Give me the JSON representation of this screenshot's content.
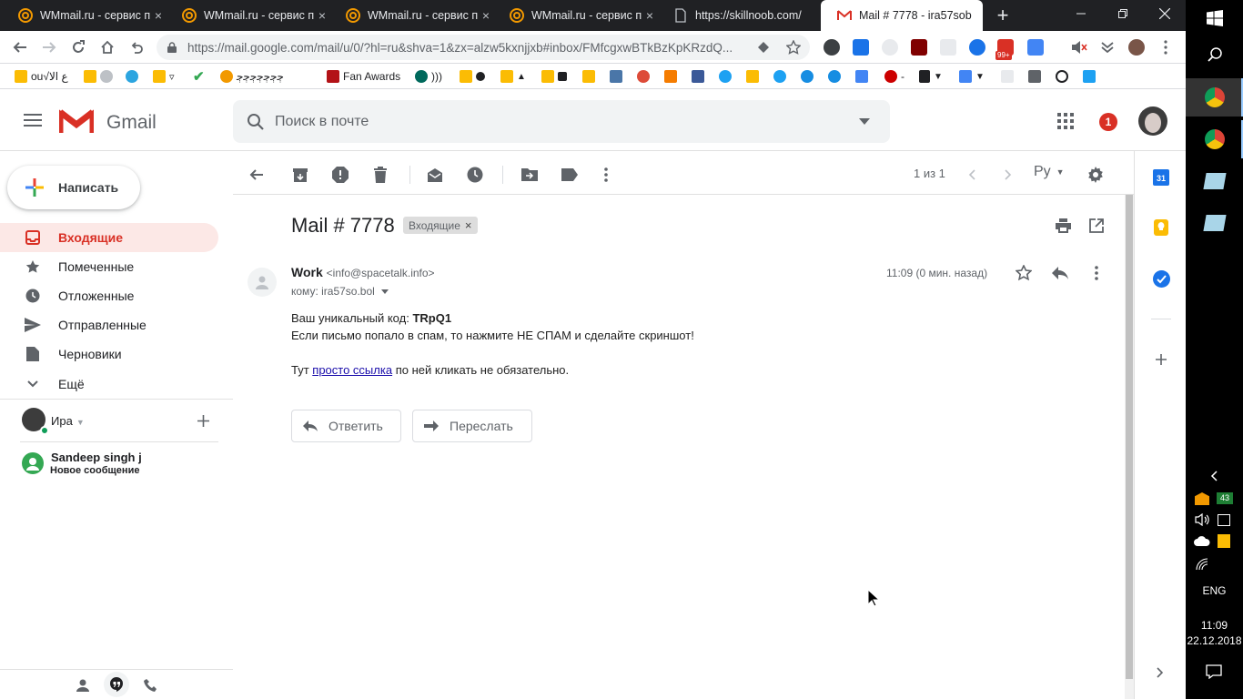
{
  "browser": {
    "tabs": [
      {
        "title": "WMmail.ru - сервис п",
        "active": false
      },
      {
        "title": "WMmail.ru - сервис п",
        "active": false
      },
      {
        "title": "WMmail.ru - сервис п",
        "active": false
      },
      {
        "title": "WMmail.ru - сервис п",
        "active": false
      },
      {
        "title": "https://skillnoob.com/",
        "active": false
      },
      {
        "title": "Mail # 7778 - ira57sob",
        "active": true
      }
    ],
    "url": "https://mail.google.com/mail/u/0/?hl=ru&shva=1&zx=alzw5kxnjjxb#inbox/FMfcgxwBTkBzKpKRzdQ...",
    "ext_badge": "99+",
    "bookmarks": {
      "b1": "ou√ع الا",
      "b5": "ﭴﭴﭴﭴﭴﭴﭴ",
      "b6": "Fan Awards",
      "b7": ")))"
    }
  },
  "gmail": {
    "logo_text": "Gmail",
    "search_placeholder": "Поиск в почте",
    "notif_count": "1",
    "compose_label": "Написать",
    "nav": {
      "inbox": "Входящие",
      "starred": "Помеченные",
      "snoozed": "Отложенные",
      "sent": "Отправленные",
      "drafts": "Черновики",
      "more": "Ещё"
    },
    "account_name": "Ира",
    "hangout": {
      "name": "Sandeep singh j",
      "status": "Новое сообщение"
    },
    "pager": "1 из 1",
    "lang": "Ру",
    "subject": "Mail # 7778",
    "label_chip": "Входящие",
    "sender_name": "Work",
    "sender_email": "<info@spacetalk.info>",
    "to_line": "кому: ira57so.bol",
    "time": "11:09 (0 мин. назад)",
    "body": {
      "line1_prefix": "Ваш уникальный код: ",
      "code": "TRpQ1",
      "line2": "Если письмо попало в спам, то нажмите НЕ СПАМ и сделайте скриншот!",
      "line3_prefix": "Тут ",
      "link": "просто ссылка",
      "line3_suffix": " по ней кликать не обязательно."
    },
    "reply_label": "Ответить",
    "forward_label": "Переслать",
    "calendar_day": "31"
  },
  "taskbar": {
    "badge_43": "43",
    "lang": "ENG",
    "time": "11:09",
    "date": "22.12.2018"
  },
  "colors": {
    "gmail_red": "#d93025",
    "inbox_bg": "#fce8e6",
    "link": "#1a0dab",
    "tabbar": "#202124"
  }
}
